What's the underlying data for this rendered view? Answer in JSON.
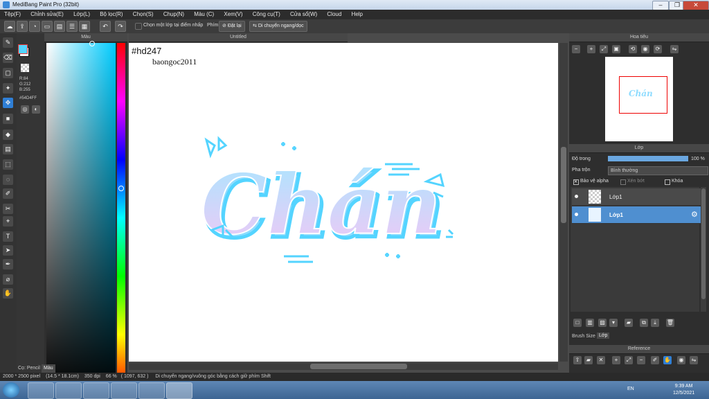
{
  "window": {
    "title": "MediBang Paint Pro (32bit)"
  },
  "menu": [
    "Tệp(F)",
    "Chỉnh sửa(E)",
    "Lớp(L)",
    "Bộ lọc(R)",
    "Chọn(S)",
    "Chụp(N)",
    "Màu (C)",
    "Xem(V)",
    "Công cụ(T)",
    "Cửa sổ(W)",
    "Cloud",
    "Help"
  ],
  "toolbar": {
    "select_layer_label": "Chọn một lớp tại điểm nhấp",
    "key_label": "Phím",
    "reset_label": "Đặt lại",
    "move_label": "Di chuyển ngang/dọc"
  },
  "color": {
    "panel_title": "Màu",
    "r": "R:84",
    "g": "G:212",
    "b": "B:255",
    "hex": "#54D4FF",
    "primary": "#54D4FF",
    "tab_pencil": "Cọ: Pencil",
    "tab_color": "Màu"
  },
  "canvas": {
    "title": "Untitled",
    "tag": "#hd247",
    "author": "baongoc2011",
    "art_text": "Chán"
  },
  "navigator": {
    "title": "Hoa tiêu"
  },
  "layers": {
    "title": "Lớp",
    "opacity_label": "Độ trong",
    "opacity_value": "100 %",
    "opacity": 1.0,
    "blend_label": "Pha trộn",
    "blend_value": "Bình thường",
    "protect_alpha": "Bảo vệ alpha",
    "clip": "Xén bớt",
    "lock": "Khóa",
    "items": [
      {
        "name": "Lớp1",
        "selected": false
      },
      {
        "name": "Lớp1",
        "selected": true
      }
    ],
    "tab_brush": "Brush Size",
    "tab_layer": "Lớp"
  },
  "reference": {
    "title": "Reference"
  },
  "status": {
    "size": "2000 * 2500 pixel",
    "cm": "(14.5 * 18.1cm)",
    "dpi": "350 dpi",
    "zoom": "66 %",
    "coords": "( 1097, 632 )",
    "hint": "Di chuyển ngang/vuông góc bằng cách giữ phím Shift"
  },
  "taskbar": {
    "lang": "EN",
    "time": "9:39 AM",
    "date": "12/5/2021"
  }
}
